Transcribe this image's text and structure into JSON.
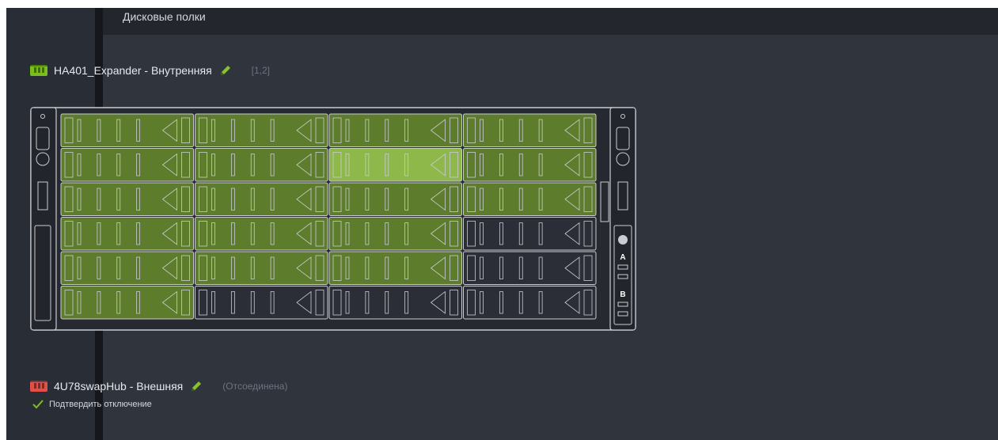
{
  "section": {
    "title": "Дисковые полки"
  },
  "shelves": [
    {
      "name": "HA401_Expander - Внутренняя",
      "meta": "[1,2]",
      "status_color": "#7bbf1f",
      "icon": "disk-shelf-icon",
      "edit_icon": "pencil-icon",
      "drive_grid": {
        "columns": 4,
        "rows": 6,
        "occupied": [
          [
            true,
            true,
            true,
            true
          ],
          [
            true,
            true,
            true,
            true
          ],
          [
            true,
            true,
            true,
            true
          ],
          [
            true,
            true,
            true,
            false
          ],
          [
            true,
            true,
            true,
            false
          ],
          [
            true,
            false,
            false,
            false
          ]
        ],
        "highlighted": [
          1,
          2
        ],
        "front_panel": [
          "A",
          "B"
        ]
      }
    },
    {
      "name": "4U78swapHub - Внешняя",
      "meta": "(Отсоединена)",
      "status_color": "#e2504a",
      "icon": "disk-shelf-icon",
      "edit_icon": "pencil-icon"
    }
  ],
  "confirm": {
    "label": "Подтвердить отключение",
    "icon": "checkmark-icon"
  },
  "colors": {
    "drive_on": "#5e7d2c",
    "drive_highlight": "#8fb84a",
    "drive_off": "#2b2e36",
    "outline": "#c9ccd1"
  }
}
